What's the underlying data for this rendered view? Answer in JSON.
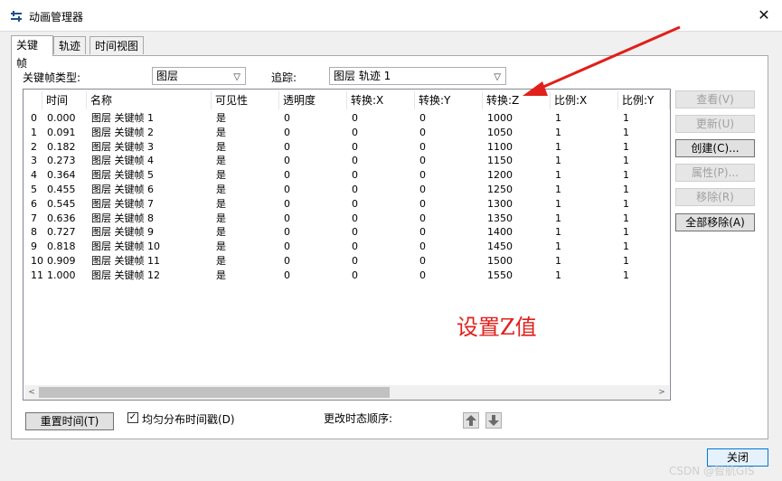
{
  "window": {
    "title": "动画管理器",
    "close_glyph": "✕"
  },
  "tabs": [
    {
      "label": "关键帧",
      "active": true
    },
    {
      "label": "轨迹",
      "active": false
    },
    {
      "label": "时间视图",
      "active": false
    }
  ],
  "filters": {
    "type_label": "关键帧类型:",
    "type_value": "图层",
    "track_label": "追踪:",
    "track_value": "图层 轨迹 1"
  },
  "table": {
    "columns": [
      "",
      "时间",
      "名称",
      "可见性",
      "透明度",
      "转换:X",
      "转换:Y",
      "转换:Z",
      "比例:X",
      "比例:Y"
    ],
    "rows": [
      [
        "0",
        "0.000",
        "图层 关键帧 1",
        "是",
        "0",
        "0",
        "0",
        "1000",
        "1",
        "1"
      ],
      [
        "1",
        "0.091",
        "图层 关键帧 2",
        "是",
        "0",
        "0",
        "0",
        "1050",
        "1",
        "1"
      ],
      [
        "2",
        "0.182",
        "图层 关键帧 3",
        "是",
        "0",
        "0",
        "0",
        "1100",
        "1",
        "1"
      ],
      [
        "3",
        "0.273",
        "图层 关键帧 4",
        "是",
        "0",
        "0",
        "0",
        "1150",
        "1",
        "1"
      ],
      [
        "4",
        "0.364",
        "图层 关键帧 5",
        "是",
        "0",
        "0",
        "0",
        "1200",
        "1",
        "1"
      ],
      [
        "5",
        "0.455",
        "图层 关键帧 6",
        "是",
        "0",
        "0",
        "0",
        "1250",
        "1",
        "1"
      ],
      [
        "6",
        "0.545",
        "图层 关键帧 7",
        "是",
        "0",
        "0",
        "0",
        "1300",
        "1",
        "1"
      ],
      [
        "7",
        "0.636",
        "图层 关键帧 8",
        "是",
        "0",
        "0",
        "0",
        "1350",
        "1",
        "1"
      ],
      [
        "8",
        "0.727",
        "图层 关键帧 9",
        "是",
        "0",
        "0",
        "0",
        "1400",
        "1",
        "1"
      ],
      [
        "9",
        "0.818",
        "图层 关键帧 10",
        "是",
        "0",
        "0",
        "0",
        "1450",
        "1",
        "1"
      ],
      [
        "10",
        "0.909",
        "图层 关键帧 11",
        "是",
        "0",
        "0",
        "0",
        "1500",
        "1",
        "1"
      ],
      [
        "11",
        "1.000",
        "图层 关键帧 12",
        "是",
        "0",
        "0",
        "0",
        "1550",
        "1",
        "1"
      ]
    ]
  },
  "side_buttons": {
    "view": "查看(V)",
    "update": "更新(U)",
    "create": "创建(C)...",
    "properties": "属性(P)...",
    "remove": "移除(R)",
    "remove_all": "全部移除(A)"
  },
  "bottom": {
    "reset_time": "重置时间(T)",
    "distribute_label": "均匀分布时间戳(D)",
    "distribute_checked": true,
    "reorder_label": "更改时态顺序:"
  },
  "footer": {
    "close_label": "关闭",
    "watermark": "CSDN @智航GIS"
  },
  "annotation": {
    "text": "设置Z值",
    "color": "#e0201b"
  }
}
